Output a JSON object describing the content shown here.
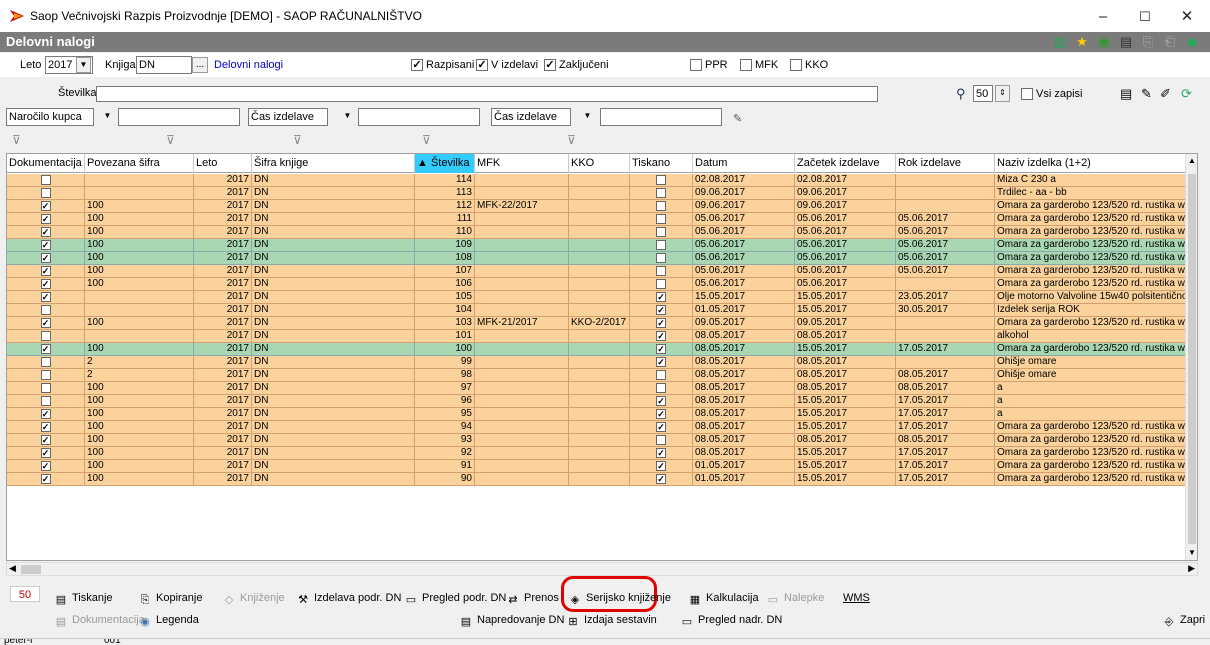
{
  "window": {
    "title": "Saop  Večnivojski Razpis Proizvodnje [DEMO] - SAOP RAČUNALNIŠTVO",
    "min": "–",
    "max": "☐",
    "close": "✕"
  },
  "panel": {
    "title": "Delovni nalogi"
  },
  "filters": {
    "leto_label": "Leto",
    "leto_value": "2017",
    "knjiga_label": "Knjiga",
    "knjiga_value": "DN",
    "knjiga_btn": "...",
    "knjiga_link": "Delovni nalogi",
    "razpisani": "Razpisani",
    "vizdelavi": "V izdelavi",
    "zakljuceni": "Zaključeni",
    "ppr": "PPR",
    "mfk": "MFK",
    "kko": "KKO",
    "stevilka_label": "Številka",
    "limit_value": "50",
    "vsi_zapisi": "Vsi zapisi",
    "narocilo": "Naročilo kupca",
    "cas1": "Čas izdelave",
    "cas2": "Čas izdelave"
  },
  "grid": {
    "columns": [
      "Dokumentacija",
      "Povezana šifra",
      "Leto",
      "Šifra knjige",
      "▲ Številka",
      "MFK",
      "KKO",
      "Tiskano",
      "Datum",
      "Začetek izdelave",
      "Rok izdelave",
      "Naziv izdelka (1+2)"
    ],
    "rows": [
      {
        "dok": false,
        "pov": "",
        "leto": "2017",
        "sifra": "DN",
        "st": "114",
        "mfk": "",
        "kko": "",
        "tisk": false,
        "datum": "02.08.2017",
        "zac": "02.08.2017",
        "rok": "",
        "naziv": "Miza C 230 a",
        "color": "orange"
      },
      {
        "dok": false,
        "pov": "",
        "leto": "2017",
        "sifra": "DN",
        "st": "113",
        "mfk": "",
        "kko": "",
        "tisk": false,
        "datum": "09.06.2017",
        "zac": "09.06.2017",
        "rok": "",
        "naziv": "Trdilec - aa - bb",
        "color": "orange"
      },
      {
        "dok": true,
        "pov": "100",
        "leto": "2017",
        "sifra": "DN",
        "st": "112",
        "mfk": "MFK-22/2017",
        "kko": "",
        "tisk": false,
        "datum": "09.06.2017",
        "zac": "09.06.2017",
        "rok": "",
        "naziv": "Omara za garderobo 123/520 rd. rustika  we65",
        "color": "orange"
      },
      {
        "dok": true,
        "pov": "100",
        "leto": "2017",
        "sifra": "DN",
        "st": "111",
        "mfk": "",
        "kko": "",
        "tisk": false,
        "datum": "05.06.2017",
        "zac": "05.06.2017",
        "rok": "05.06.2017",
        "naziv": "Omara za garderobo 123/520 rd. rustika  we65",
        "color": "orange"
      },
      {
        "dok": true,
        "pov": "100",
        "leto": "2017",
        "sifra": "DN",
        "st": "110",
        "mfk": "",
        "kko": "",
        "tisk": false,
        "datum": "05.06.2017",
        "zac": "05.06.2017",
        "rok": "05.06.2017",
        "naziv": "Omara za garderobo 123/520 rd. rustika  we65",
        "color": "orange"
      },
      {
        "dok": true,
        "pov": "100",
        "leto": "2017",
        "sifra": "DN",
        "st": "109",
        "mfk": "",
        "kko": "",
        "tisk": false,
        "datum": "05.06.2017",
        "zac": "05.06.2017",
        "rok": "05.06.2017",
        "naziv": "Omara za garderobo 123/520 rd. rustika  we65",
        "color": "green"
      },
      {
        "dok": true,
        "pov": "100",
        "leto": "2017",
        "sifra": "DN",
        "st": "108",
        "mfk": "",
        "kko": "",
        "tisk": false,
        "datum": "05.06.2017",
        "zac": "05.06.2017",
        "rok": "05.06.2017",
        "naziv": "Omara za garderobo 123/520 rd. rustika  we65",
        "color": "green"
      },
      {
        "dok": true,
        "pov": "100",
        "leto": "2017",
        "sifra": "DN",
        "st": "107",
        "mfk": "",
        "kko": "",
        "tisk": false,
        "datum": "05.06.2017",
        "zac": "05.06.2017",
        "rok": "05.06.2017",
        "naziv": "Omara za garderobo 123/520 rd. rustika  we65",
        "color": "orange"
      },
      {
        "dok": true,
        "pov": "100",
        "leto": "2017",
        "sifra": "DN",
        "st": "106",
        "mfk": "",
        "kko": "",
        "tisk": false,
        "datum": "05.06.2017",
        "zac": "05.06.2017",
        "rok": "",
        "naziv": "Omara za garderobo 123/520 rd. rustika  we65",
        "color": "orange"
      },
      {
        "dok": true,
        "pov": "",
        "leto": "2017",
        "sifra": "DN",
        "st": "105",
        "mfk": "",
        "kko": "",
        "tisk": true,
        "datum": "15.05.2017",
        "zac": "15.05.2017",
        "rok": "23.05.2017",
        "naziv": "Olje motorno Valvoline 15w40 polsitentično",
        "color": "orange"
      },
      {
        "dok": false,
        "pov": "",
        "leto": "2017",
        "sifra": "DN",
        "st": "104",
        "mfk": "",
        "kko": "",
        "tisk": true,
        "datum": "01.05.2017",
        "zac": "15.05.2017",
        "rok": "30.05.2017",
        "naziv": "Izdelek serija ROK",
        "color": "orange"
      },
      {
        "dok": true,
        "pov": "100",
        "leto": "2017",
        "sifra": "DN",
        "st": "103",
        "mfk": "MFK-21/2017",
        "kko": "KKO-2/2017",
        "tisk": true,
        "datum": "09.05.2017",
        "zac": "09.05.2017",
        "rok": "",
        "naziv": "Omara za garderobo 123/520 rd. rustika  we65",
        "color": "orange"
      },
      {
        "dok": false,
        "pov": "",
        "leto": "2017",
        "sifra": "DN",
        "st": "101",
        "mfk": "",
        "kko": "",
        "tisk": true,
        "datum": "08.05.2017",
        "zac": "08.05.2017",
        "rok": "",
        "naziv": "alkohol",
        "color": "orange"
      },
      {
        "dok": true,
        "pov": "100",
        "leto": "2017",
        "sifra": "DN",
        "st": "100",
        "mfk": "",
        "kko": "",
        "tisk": true,
        "datum": "08.05.2017",
        "zac": "15.05.2017",
        "rok": "17.05.2017",
        "naziv": "Omara za garderobo 123/520 rd. rustika  we65",
        "color": "green"
      },
      {
        "dok": false,
        "pov": "2",
        "leto": "2017",
        "sifra": "DN",
        "st": "99",
        "mfk": "",
        "kko": "",
        "tisk": true,
        "datum": "08.05.2017",
        "zac": "08.05.2017",
        "rok": "",
        "naziv": "Ohišje omare",
        "color": "orange"
      },
      {
        "dok": false,
        "pov": "2",
        "leto": "2017",
        "sifra": "DN",
        "st": "98",
        "mfk": "",
        "kko": "",
        "tisk": false,
        "datum": "08.05.2017",
        "zac": "08.05.2017",
        "rok": "08.05.2017",
        "naziv": "Ohišje omare",
        "color": "orange"
      },
      {
        "dok": false,
        "pov": "100",
        "leto": "2017",
        "sifra": "DN",
        "st": "97",
        "mfk": "",
        "kko": "",
        "tisk": false,
        "datum": "08.05.2017",
        "zac": "08.05.2017",
        "rok": "08.05.2017",
        "naziv": "a",
        "color": "orange"
      },
      {
        "dok": false,
        "pov": "100",
        "leto": "2017",
        "sifra": "DN",
        "st": "96",
        "mfk": "",
        "kko": "",
        "tisk": true,
        "datum": "08.05.2017",
        "zac": "15.05.2017",
        "rok": "17.05.2017",
        "naziv": "a",
        "color": "orange"
      },
      {
        "dok": true,
        "pov": "100",
        "leto": "2017",
        "sifra": "DN",
        "st": "95",
        "mfk": "",
        "kko": "",
        "tisk": true,
        "datum": "08.05.2017",
        "zac": "15.05.2017",
        "rok": "17.05.2017",
        "naziv": "a",
        "color": "orange"
      },
      {
        "dok": true,
        "pov": "100",
        "leto": "2017",
        "sifra": "DN",
        "st": "94",
        "mfk": "",
        "kko": "",
        "tisk": true,
        "datum": "08.05.2017",
        "zac": "15.05.2017",
        "rok": "17.05.2017",
        "naziv": "Omara za garderobo 123/520 rd. rustika  we65",
        "color": "orange"
      },
      {
        "dok": true,
        "pov": "100",
        "leto": "2017",
        "sifra": "DN",
        "st": "93",
        "mfk": "",
        "kko": "",
        "tisk": false,
        "datum": "08.05.2017",
        "zac": "08.05.2017",
        "rok": "08.05.2017",
        "naziv": "Omara za garderobo 123/520 rd. rustika  we65",
        "color": "orange"
      },
      {
        "dok": true,
        "pov": "100",
        "leto": "2017",
        "sifra": "DN",
        "st": "92",
        "mfk": "",
        "kko": "",
        "tisk": true,
        "datum": "08.05.2017",
        "zac": "15.05.2017",
        "rok": "17.05.2017",
        "naziv": "Omara za garderobo 123/520 rd. rustika  we65",
        "color": "orange"
      },
      {
        "dok": true,
        "pov": "100",
        "leto": "2017",
        "sifra": "DN",
        "st": "91",
        "mfk": "",
        "kko": "",
        "tisk": true,
        "datum": "01.05.2017",
        "zac": "15.05.2017",
        "rok": "17.05.2017",
        "naziv": "Omara za garderobo 123/520 rd. rustika  we65",
        "color": "orange"
      },
      {
        "dok": true,
        "pov": "100",
        "leto": "2017",
        "sifra": "DN",
        "st": "90",
        "mfk": "",
        "kko": "",
        "tisk": true,
        "datum": "01.05.2017",
        "zac": "15.05.2017",
        "rok": "17.05.2017",
        "naziv": "Omara za garderobo 123/520 rd. rustika  we65",
        "color": "orange"
      }
    ]
  },
  "bottom": {
    "count": "50",
    "tiskanje": "Tiskanje",
    "kopiranje": "Kopiranje",
    "knjizenje": "Knjiženje",
    "izdelava": "Izdelava podr. DN",
    "pregled": "Pregled podr. DN",
    "prenos": "Prenos",
    "serijsko": "Serijsko knjiženje",
    "kalkulacija": "Kalkulacija",
    "nalepke": "Nalepke",
    "wms": "WMS",
    "dokumentacija": "Dokumentacija",
    "legenda": "Legenda",
    "napredovanje": "Napredovanje DN",
    "izdaja": "Izdaja sestavin",
    "pregled_nadr": "Pregled nadr. DN",
    "zapri": "Zapri"
  },
  "status": {
    "user": "peter-i",
    "code": "001"
  },
  "colors": {
    "orange_row": "#fcd29c",
    "green_row": "#a9d6b3",
    "sorted_header": "#33ccff",
    "highlight": "#e00000"
  }
}
